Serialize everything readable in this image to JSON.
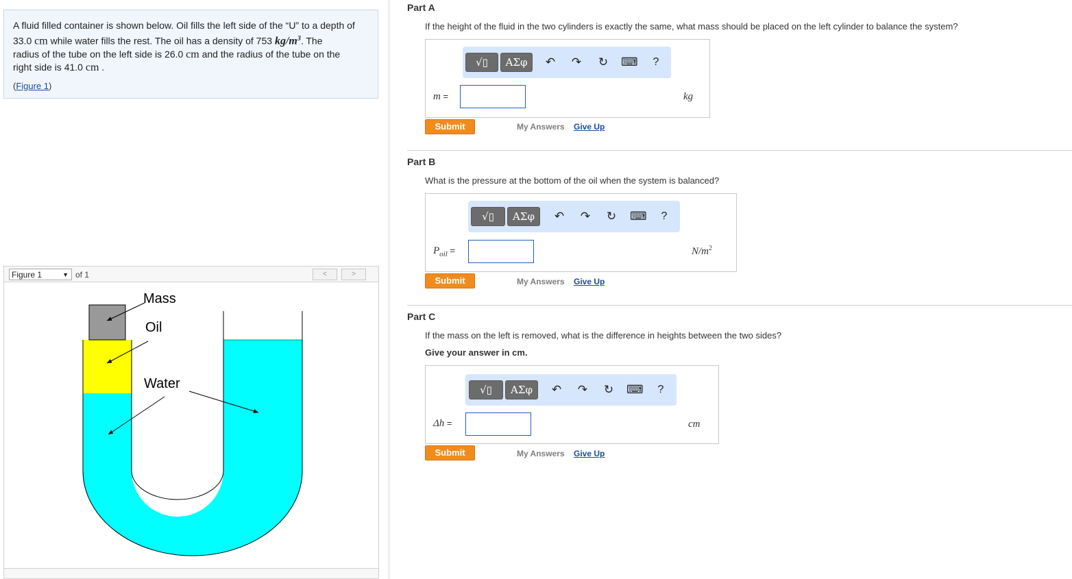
{
  "problem": {
    "line1": "A fluid filled container is shown below.  Oil fills the left side of the “U” to a depth of",
    "depth_value": "33.0",
    "depth_unit": "cm",
    "line2_mid": " while water fills the rest.  The oil has a density of 753 ",
    "density_unit": "kg/m",
    "density_exp": "3",
    "line2_end": ".  The",
    "line3": "radius of the tube on the left side is 26.0 ",
    "r1_unit": "cm",
    "line3_end": " and the radius of the tube on the",
    "line4": "right side is 41.0 ",
    "r2_unit": "cm",
    "line4_end": " .",
    "figure_link_open": "(",
    "figure_link": "Figure 1",
    "figure_link_close": ")"
  },
  "figure_nav": {
    "selected": "Figure 1",
    "of_text": "of 1",
    "prev": "<",
    "next": ">"
  },
  "figure": {
    "label_mass": "Mass",
    "label_oil": "Oil",
    "label_water": "Water",
    "colors": {
      "water": "#00ffff",
      "oil": "#ffff00",
      "mass": "#999999"
    }
  },
  "toolbar": {
    "templates_label": "√▯",
    "greek_label": "ΑΣφ",
    "undo_icon": "↶",
    "redo_icon": "↷",
    "reset_icon": "↻",
    "keyboard_icon": "⌨",
    "help_label": "?"
  },
  "parts": [
    {
      "title": "Part A",
      "question": "If the height of the fluid in the two cylinders is exactly the same, what mass should be placed on the left cylinder to balance the system?",
      "var": "m",
      "var_sub": "",
      "eq": " =",
      "unit": "kg",
      "unit_sup": "",
      "submit": "Submit",
      "my_answers": "My Answers",
      "give_up": "Give Up"
    },
    {
      "title": "Part B",
      "question": "What is the pressure at the bottom of the oil when the system is balanced?",
      "var": "P",
      "var_sub": "oil",
      "eq": " =",
      "unit": "N/m",
      "unit_sup": "2",
      "submit": "Submit",
      "my_answers": "My Answers",
      "give_up": "Give Up"
    },
    {
      "title": "Part C",
      "question": "If the mass on the left is removed, what is the difference in heights between the two sides?",
      "note": "Give your answer in cm.",
      "var": "Δh",
      "var_sub": "",
      "eq": " =",
      "unit": "cm",
      "unit_sup": "",
      "submit": "Submit",
      "my_answers": "My Answers",
      "give_up": "Give Up"
    }
  ]
}
